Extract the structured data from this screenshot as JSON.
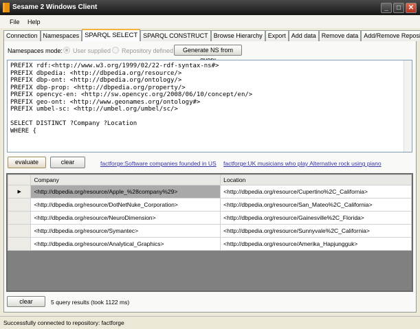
{
  "window": {
    "title": "Sesame 2 Windows Client",
    "minimize": "_",
    "maximize": "□",
    "close": "✕"
  },
  "menu": [
    "File",
    "Help"
  ],
  "tabs": [
    "Connection",
    "Namespaces",
    "SPARQL SELECT",
    "SPARQL CONSTRUCT",
    "Browse Hierarchy",
    "Export",
    "Add data",
    "Remove data",
    "Add/Remove Repository"
  ],
  "active_tab": "SPARQL SELECT",
  "namespaces": {
    "label": "Namespaces mode:",
    "option_user": "User supplied",
    "option_repo": "Repository defined",
    "selected": "User supplied",
    "generate_button": "Generate NS from query"
  },
  "query": "PREFIX rdf:<http://www.w3.org/1999/02/22-rdf-syntax-ns#>\nPREFIX dbpedia: <http://dbpedia.org/resource/>\nPREFIX dbp-ont: <http://dbpedia.org/ontology/>\nPREFIX dbp-prop: <http://dbpedia.org/property/>\nPREFIX opencyc-en: <http://sw.opencyc.org/2008/06/10/concept/en/>\nPREFIX geo-ont: <http://www.geonames.org/ontology#>\nPREFIX umbel-sc: <http://umbel.org/umbel/sc/>\n\nSELECT DISTINCT ?Company ?Location\nWHERE {",
  "actions": {
    "evaluate": "evaluate",
    "clear": "clear",
    "link1": "factforge:Software companies founded in US",
    "link2": "factforge:UK musicians who play Alternative rock using piano"
  },
  "results": {
    "columns": [
      "Company",
      "Location"
    ],
    "rows": [
      [
        "<http://dbpedia.org/resource/Apple_%28company%29>",
        "<http://dbpedia.org/resource/Cupertino%2C_California>"
      ],
      [
        "<http://dbpedia.org/resource/DotNetNuke_Corporation>",
        "<http://dbpedia.org/resource/San_Mateo%2C_California>"
      ],
      [
        "<http://dbpedia.org/resource/NeuroDimension>",
        "<http://dbpedia.org/resource/Gainesville%2C_Florida>"
      ],
      [
        "<http://dbpedia.org/resource/Symantec>",
        "<http://dbpedia.org/resource/Sunnyvale%2C_California>"
      ],
      [
        "<http://dbpedia.org/resource/Analytical_Graphics>",
        "<http://dbpedia.org/resource/Amerika_Hapjungguk>"
      ]
    ],
    "current_row_marker": "▶"
  },
  "bottom": {
    "clear": "clear",
    "summary": "5 query results (took 1122 ms)"
  },
  "status": "Successfully connected to repository: factforge"
}
